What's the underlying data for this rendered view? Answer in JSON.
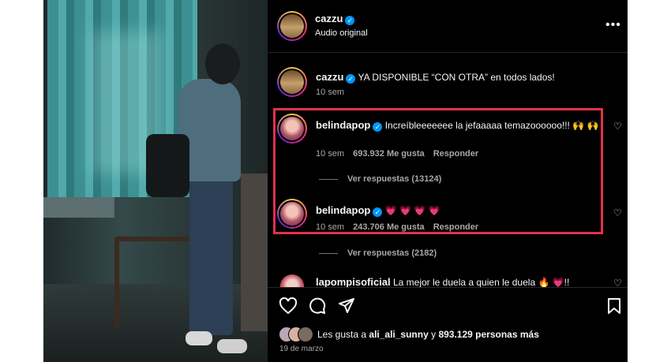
{
  "post_header": {
    "username": "cazzu",
    "audio_label": "Audio original",
    "more_icon": "more-options-icon"
  },
  "caption": {
    "username": "cazzu",
    "text": "YA DISPONIBLE “CON OTRA” en todos lados!",
    "time": "10 sem"
  },
  "comments": [
    {
      "username": "belindapop",
      "text": "Increíbleeeeeee la jefaaaaa temazoooooo!!! 🙌 🙌",
      "time": "10 sem",
      "likes": "693.932 Me gusta",
      "reply_label": "Responder",
      "view_replies": "Ver respuestas (13124)"
    },
    {
      "username": "belindapop",
      "text": "💗 💗 💗 💗",
      "time": "10 sem",
      "likes": "243.706 Me gusta",
      "reply_label": "Responder",
      "view_replies": "Ver respuestas (2182)"
    },
    {
      "username": "lapompisoficial",
      "text": "La mejor le duela a quien le duela 🔥 💗!!"
    }
  ],
  "likes_summary": {
    "prefix": "Les gusta a",
    "user": "ali_ali_sunny",
    "connector": "y",
    "others": "893.129 personas más"
  },
  "post_date": "19 de marzo",
  "colors": {
    "highlight": "#e0314b",
    "verified": "#0095f6",
    "panel_bg": "#000000"
  },
  "icons": [
    "like-icon",
    "comment-icon",
    "share-icon",
    "save-icon",
    "heart-icon",
    "verified-icon"
  ]
}
